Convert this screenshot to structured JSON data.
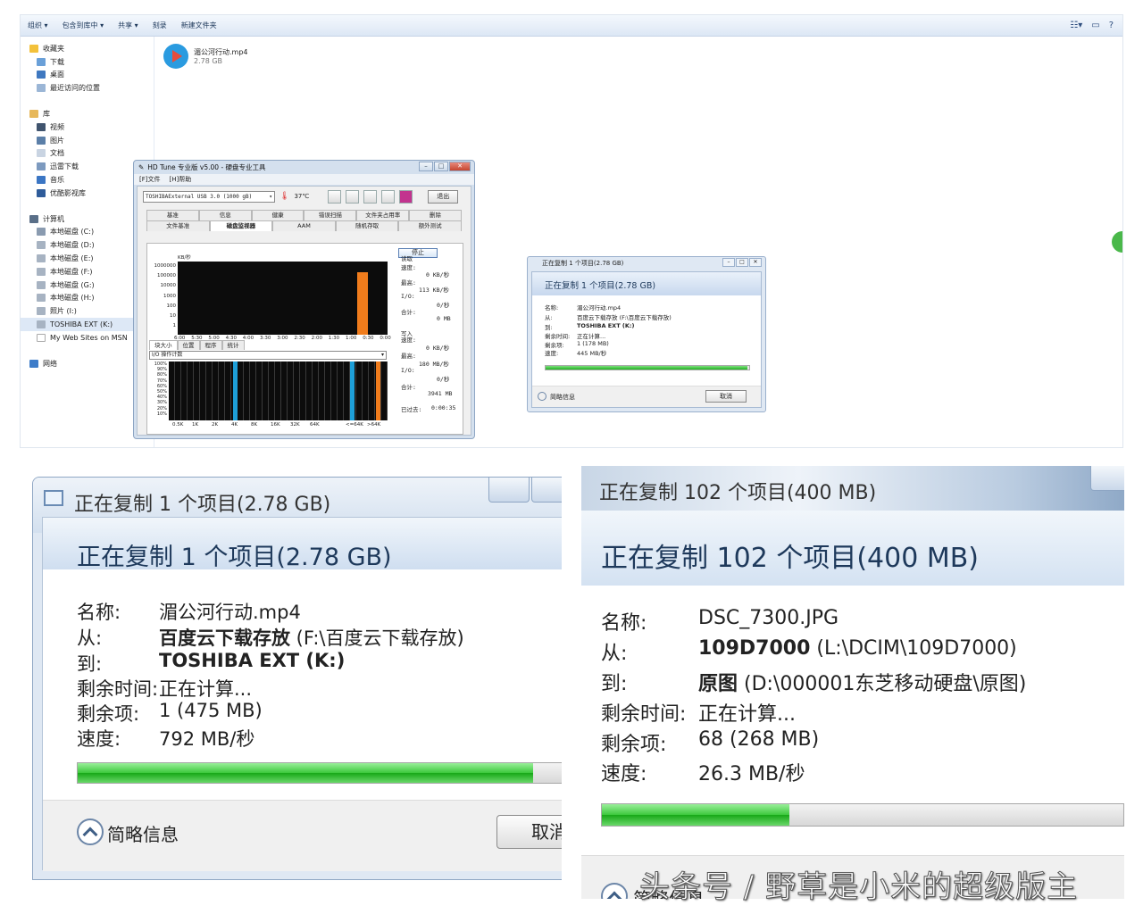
{
  "explorer": {
    "toolbar": [
      "组织 ▾",
      "包含到库中 ▾",
      "共享 ▾",
      "刻录",
      "新建文件夹"
    ],
    "nav": {
      "favorites": "收藏夹",
      "favorites_items": [
        "下载",
        "桌面",
        "最近访问的位置"
      ],
      "libraries": "库",
      "libraries_items": [
        "视频",
        "图片",
        "文档",
        "迅雷下载",
        "音乐",
        "优酷影视库"
      ],
      "computer": "计算机",
      "computer_items": [
        "本地磁盘 (C:)",
        "本地磁盘 (D:)",
        "本地磁盘 (E:)",
        "本地磁盘 (F:)",
        "本地磁盘 (G:)",
        "本地磁盘 (H:)",
        "照片 (I:)",
        "TOSHIBA EXT (K:)",
        "My Web Sites on MSN"
      ],
      "network": "网络"
    },
    "file": {
      "name": "湄公河行动.mp4",
      "size": "2.78 GB"
    }
  },
  "hdtune": {
    "title": "HD Tune 专业版 v5.00 - 硬盘专业工具",
    "menu": [
      "[F]文件",
      "[H]帮助"
    ],
    "drive": "TOSHIBAExternal USB 3.0 (1000 gB)",
    "temp": "37℃",
    "exit": "退出",
    "tabs_row1": [
      "基准",
      "信息",
      "健康",
      "错误扫描",
      "文件夹占用率",
      "删除"
    ],
    "tabs_row2": [
      "文件基准",
      "磁盘监视器",
      "AAM",
      "随机存取",
      "额外测试"
    ],
    "active_tab": "磁盘监视器",
    "stop": "停止",
    "unit": "KB/秒",
    "y_ticks": [
      "1000000",
      "100000",
      "10000",
      "1000",
      "100",
      "10",
      "1"
    ],
    "x_ticks": [
      "6:00",
      "5:30",
      "5:00",
      "4:30",
      "4:00",
      "3:30",
      "3:00",
      "2:30",
      "2:00",
      "1:30",
      "1:00",
      "0:30",
      "0:00"
    ],
    "read": {
      "label": "读取",
      "speed_label": "速度:",
      "speed": "0 KB/秒",
      "max_label": "最高:",
      "max": "113 KB/秒",
      "io_label": "I/O:",
      "io": "0/秒",
      "total_label": "合计:",
      "total": "0 MB"
    },
    "write": {
      "label": "写入",
      "speed_label": "速度:",
      "speed": "0 KB/秒",
      "max_label": "最高:",
      "max": "180 MB/秒",
      "io_label": "I/O:",
      "io": "0/秒",
      "total_label": "合计:",
      "total": "3941 MB"
    },
    "elapsed_label": "已过去:",
    "elapsed": "0:00:35",
    "subtabs": [
      "块大小",
      "位置",
      "程序",
      "统计"
    ],
    "io_select": "I/O 操作计数",
    "pct_ticks": [
      "100%",
      "90%",
      "80%",
      "70%",
      "60%",
      "50%",
      "40%",
      "30%",
      "20%",
      "10%"
    ],
    "block_ticks": [
      "0.5K",
      "1K",
      "2K",
      "4K",
      "8K",
      "16K",
      "32K",
      "64K",
      "<=64K",
      ">64K"
    ]
  },
  "small_copy": {
    "title": "正在复制 1 个项目(2.78 GB)",
    "header": "正在复制 1 个项目(2.78 GB)",
    "rows": [
      {
        "k": "名称:",
        "v": "湄公河行动.mp4"
      },
      {
        "k": "从:",
        "v": "百度云下载存放 (F:\\百度云下载存放)"
      },
      {
        "k": "到:",
        "v": "TOSHIBA EXT (K:)"
      },
      {
        "k": "剩余时间:",
        "v": "正在计算..."
      },
      {
        "k": "剩余项:",
        "v": "1 (178 MB)"
      },
      {
        "k": "速度:",
        "v": "445 MB/秒"
      }
    ],
    "progress": 0.99,
    "more": "简略信息",
    "cancel": "取消"
  },
  "copy_left": {
    "title": "正在复制 1 个项目(2.78 GB)",
    "header": "正在复制 1 个项目(2.78 GB)",
    "name_k": "名称:",
    "name_v": "湄公河行动.mp4",
    "from_k": "从:",
    "from_bold": "百度云下载存放",
    "from_rest": " (F:\\百度云下载存放)",
    "to_k": "到:",
    "to_bold": "TOSHIBA EXT (K:)",
    "to_rest": "",
    "time_k": "剩余时间:",
    "time_v": "正在计算...",
    "items_k": "剩余项:",
    "items_v": "1 (475 MB)",
    "speed_k": "速度:",
    "speed_v": "792 MB/秒",
    "progress": 0.94,
    "more": "简略信息",
    "cancel": "取消"
  },
  "copy_right": {
    "title": "正在复制 102 个项目(400 MB)",
    "header": "正在复制 102 个项目(400 MB)",
    "name_k": "名称:",
    "name_v": "DSC_7300.JPG",
    "from_k": "从:",
    "from_bold": "109D7000",
    "from_rest": " (L:\\DCIM\\109D7000)",
    "to_k": "到:",
    "to_bold": "原图",
    "to_rest": " (D:\\000001东芝移动硬盘\\原图)",
    "time_k": "剩余时间:",
    "time_v": "正在计算...",
    "items_k": "剩余项:",
    "items_v": "68 (268 MB)",
    "speed_k": "速度:",
    "speed_v": "26.3 MB/秒",
    "progress": 0.36,
    "more": "简略信息"
  },
  "watermark": "头条号 / 野草是小米的超级版主",
  "colors": {
    "progress_green": "#21b121",
    "hd_write_bar": "#f07c1c",
    "hd_io_bar": "#1e9fd8"
  }
}
